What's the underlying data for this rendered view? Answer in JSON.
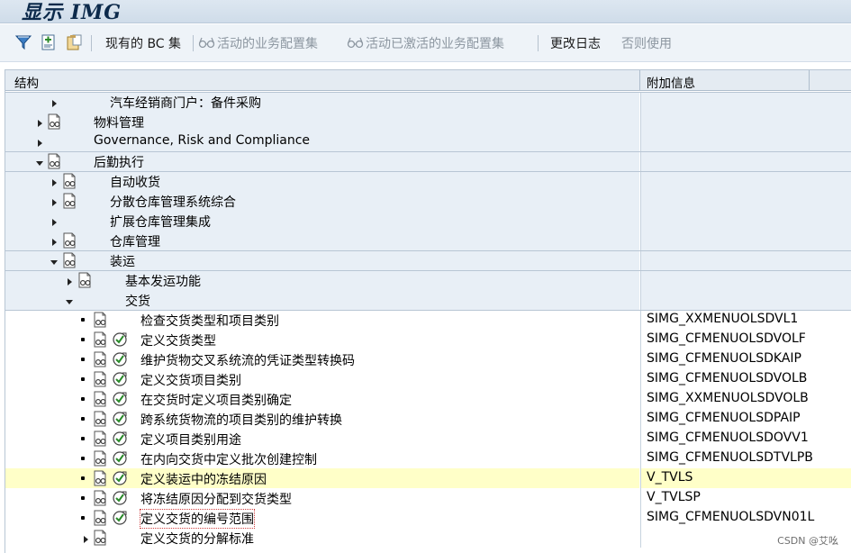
{
  "window": {
    "title": "显示 IMG"
  },
  "toolbar": {
    "current_bc": "现有的 BC 集",
    "active_config": "活动的业务配置集",
    "activated_config": "活动已激活的业务配置集",
    "change_log": "更改日志",
    "otherwise_use": "否则使用"
  },
  "grid": {
    "col_structure": "结构",
    "col_additional": "附加信息",
    "rows": [
      {
        "label": "汽车经销商门户：备件采购",
        "additional": ""
      },
      {
        "label": "物料管理",
        "additional": ""
      },
      {
        "label": "Governance, Risk and Compliance",
        "additional": ""
      },
      {
        "label": "后勤执行",
        "additional": ""
      },
      {
        "label": "自动收货",
        "additional": ""
      },
      {
        "label": "分散仓库管理系统综合",
        "additional": ""
      },
      {
        "label": "扩展仓库管理集成",
        "additional": ""
      },
      {
        "label": "仓库管理",
        "additional": ""
      },
      {
        "label": "装运",
        "additional": ""
      },
      {
        "label": "基本发运功能",
        "additional": ""
      },
      {
        "label": "交货",
        "additional": ""
      },
      {
        "label": "检查交货类型和项目类别",
        "additional": "SIMG_XXMENUOLSDVL1"
      },
      {
        "label": "定义交货类型",
        "additional": "SIMG_CFMENUOLSDVOLF"
      },
      {
        "label": "维护货物交叉系统流的凭证类型转换码",
        "additional": "SIMG_CFMENUOLSDKAIP"
      },
      {
        "label": "定义交货项目类别",
        "additional": "SIMG_CFMENUOLSDVOLB"
      },
      {
        "label": "在交货时定义项目类别确定",
        "additional": "SIMG_XXMENUOLSDVOLB"
      },
      {
        "label": "跨系统货物流的项目类别的维护转换",
        "additional": "SIMG_CFMENUOLSDPAIP"
      },
      {
        "label": "定义项目类别用途",
        "additional": "SIMG_CFMENUOLSDOVV1"
      },
      {
        "label": "在内向交货中定义批次创建控制",
        "additional": "SIMG_CFMENUOLSDTVLPB"
      },
      {
        "label": "定义装运中的冻结原因",
        "additional": "V_TVLS"
      },
      {
        "label": "将冻结原因分配到交货类型",
        "additional": "V_TVLSP"
      },
      {
        "label": "定义交货的编号范围",
        "additional": "SIMG_CFMENUOLSDVN01L"
      },
      {
        "label": "定义交货的分解标准",
        "additional": ""
      }
    ]
  },
  "watermark": "CSDN @艾吆"
}
